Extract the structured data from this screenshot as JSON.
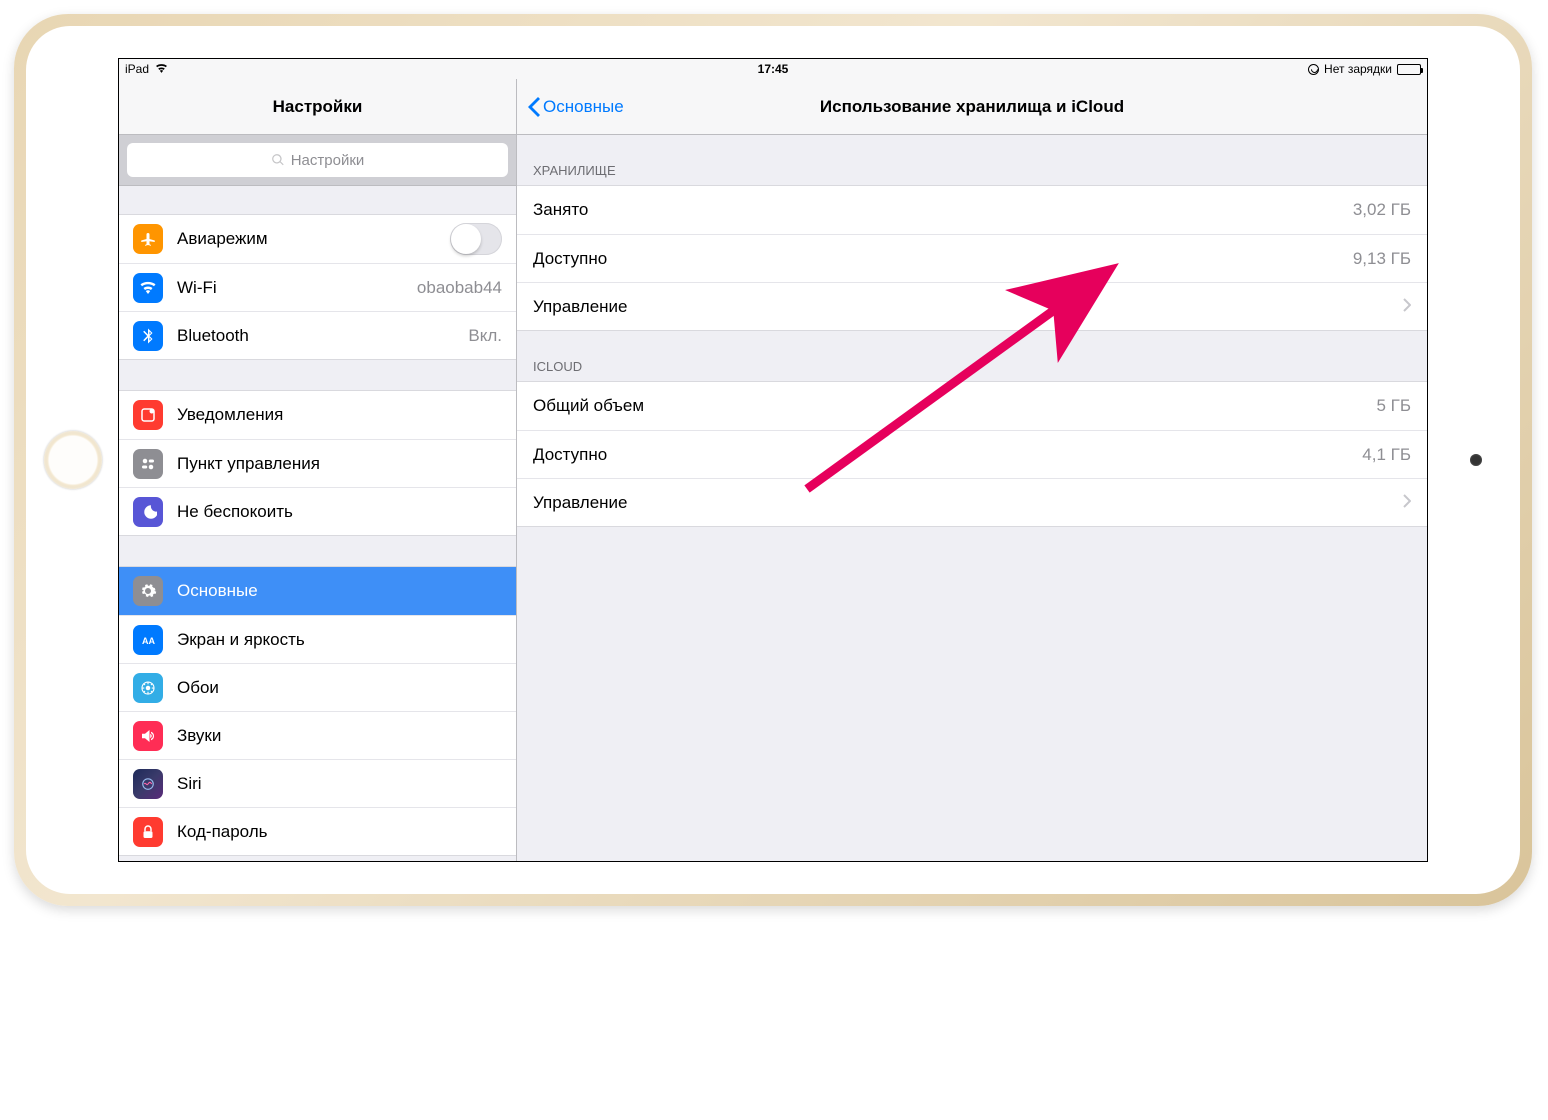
{
  "status_bar": {
    "device": "iPad",
    "time": "17:45",
    "charging_label": "Нет зарядки"
  },
  "sidebar": {
    "title": "Настройки",
    "search_placeholder": "Настройки",
    "groups": [
      {
        "items": [
          {
            "id": "airplane",
            "label": "Авиарежим",
            "toggle": false
          },
          {
            "id": "wifi",
            "label": "Wi-Fi",
            "value": "obaobab44"
          },
          {
            "id": "bluetooth",
            "label": "Bluetooth",
            "value": "Вкл."
          }
        ]
      },
      {
        "items": [
          {
            "id": "notifications",
            "label": "Уведомления"
          },
          {
            "id": "control-center",
            "label": "Пункт управления"
          },
          {
            "id": "dnd",
            "label": "Не беспокоить"
          }
        ]
      },
      {
        "items": [
          {
            "id": "general",
            "label": "Основные",
            "selected": true
          },
          {
            "id": "display",
            "label": "Экран и яркость"
          },
          {
            "id": "wallpaper",
            "label": "Обои"
          },
          {
            "id": "sounds",
            "label": "Звуки"
          },
          {
            "id": "siri",
            "label": "Siri"
          },
          {
            "id": "passcode",
            "label": "Код-пароль"
          }
        ]
      }
    ]
  },
  "detail": {
    "back_label": "Основные",
    "title": "Использование хранилища и iCloud",
    "sections": [
      {
        "header": "ХРАНИЛИЩЕ",
        "rows": [
          {
            "label": "Занято",
            "value": "3,02 ГБ"
          },
          {
            "label": "Доступно",
            "value": "9,13 ГБ"
          },
          {
            "label": "Управление",
            "chevron": true
          }
        ]
      },
      {
        "header": "ICLOUD",
        "rows": [
          {
            "label": "Общий объем",
            "value": "5 ГБ"
          },
          {
            "label": "Доступно",
            "value": "4,1 ГБ"
          },
          {
            "label": "Управление",
            "chevron": true
          }
        ]
      }
    ]
  }
}
